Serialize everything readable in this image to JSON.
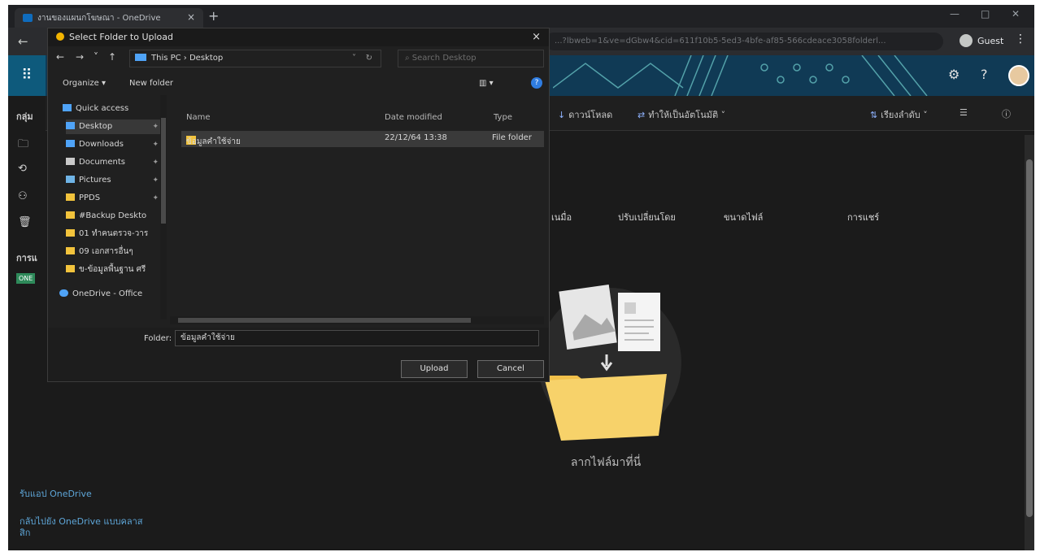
{
  "browser": {
    "tab_title": "งานของแผนกโฆษณา - OneDrive",
    "tab_close": "×",
    "new_tab": "+",
    "url": "...?lbweb=1&ve=dGbw4&cid=611f10b5-5ed3-4bfe-af85-566cdeace3058folderl...",
    "guest_label": "Guest",
    "menu": "⋮",
    "back": "←"
  },
  "header": {
    "waffle": "⠿",
    "icons": [
      "⚙",
      "?"
    ]
  },
  "leftnav": {
    "section_groups": "กลุ่ม",
    "section_shared": "การแ",
    "icons": [
      "🗀",
      "⟲",
      "⚇",
      "🗑"
    ],
    "badge": "ONE"
  },
  "commandbar": {
    "download": "ดาวน์โหลด",
    "make_offline": "ทำให้เป็นอัตโนมัติ",
    "sort": "เรียงลำดับ",
    "view": "☰",
    "info": "ⓘ"
  },
  "columns": {
    "col_a": "เนมื่อ",
    "col_b": "ปรับเปลี่ยนโดย",
    "col_c": "ขนาดไฟล์",
    "col_d": "การแชร์"
  },
  "empty_state": {
    "drop_text": "ลากไฟล์มาที่นี่"
  },
  "bottom_links": {
    "premium": "รับแอป OneDrive",
    "classic_line1": "กลับไปยัง OneDrive แบบคลาส",
    "classic_line2": "สิก"
  },
  "dialog": {
    "title": "Select Folder to Upload",
    "close": "×",
    "nav": {
      "back": "←",
      "forward": "→",
      "recent": "˅",
      "up": "↑"
    },
    "breadcrumb": "This PC › Desktop",
    "search_placeholder": "Search Desktop",
    "organize": "Organize ▾",
    "new_folder": "New folder",
    "view_toggle": "▥ ▾",
    "help": "?",
    "tree": [
      {
        "label": "Quick access",
        "color": "#4fa3f7",
        "pin": ""
      },
      {
        "label": "Desktop",
        "color": "#4fa3f7",
        "pin": "📌"
      },
      {
        "label": "Downloads",
        "color": "#4fa3f7",
        "pin": "📌"
      },
      {
        "label": "Documents",
        "color": "#c9c9c9",
        "pin": "📌"
      },
      {
        "label": "Pictures",
        "color": "#6fb4e6",
        "pin": "📌"
      },
      {
        "label": "PPDS",
        "color": "#f2c33c",
        "pin": "📌"
      },
      {
        "label": "#Backup Deskto",
        "color": "#f2c33c",
        "pin": ""
      },
      {
        "label": "01 ทำคนตรวจ-วาร",
        "color": "#f2c33c",
        "pin": ""
      },
      {
        "label": "09 เอกสารอื่นๆ",
        "color": "#f2c33c",
        "pin": ""
      },
      {
        "label": "ข-ข้อมูลพื้นฐาน ศรี",
        "color": "#f2c33c",
        "pin": ""
      },
      {
        "label": "OneDrive - Office",
        "color": "#4fa3f7",
        "pin": ""
      }
    ],
    "list_headers": {
      "name": "Name",
      "date": "Date modified",
      "type": "Type"
    },
    "rows": [
      {
        "name": "ข้อมูลคำใช้จ่าย",
        "date": "22/12/64 13:38",
        "type": "File folder"
      }
    ],
    "folder_label": "Folder:",
    "folder_value": "ข้อมูลคำใช้จ่าย",
    "upload": "Upload",
    "cancel": "Cancel"
  }
}
